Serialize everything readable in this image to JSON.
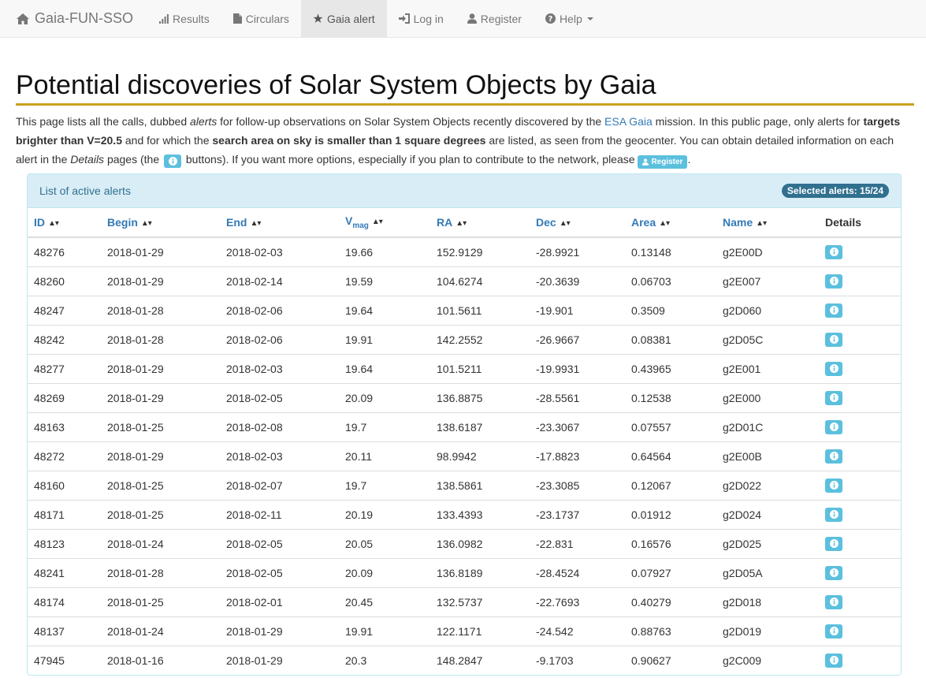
{
  "navbar": {
    "brand": "Gaia-FUN-SSO",
    "items": [
      {
        "label": "Results",
        "icon": "bar-chart-icon"
      },
      {
        "label": "Circulars",
        "icon": "file-icon"
      },
      {
        "label": "Gaia alert",
        "icon": "star-icon",
        "active": true
      },
      {
        "label": "Log in",
        "icon": "login-icon"
      },
      {
        "label": "Register",
        "icon": "user-icon"
      },
      {
        "label": "Help",
        "icon": "question-circle-icon",
        "dropdown": true
      }
    ]
  },
  "page": {
    "title": "Potential discoveries of Solar System Objects by Gaia",
    "intro": {
      "t1": "This page lists all the calls, dubbed ",
      "t2": "alerts",
      "t3": " for follow-up observations on Solar System Objects recently discovered by the ",
      "link": "ESA Gaia",
      "t4": " mission. In this public page, only alerts for ",
      "b1": "targets brighter than V=20.5",
      "t5": " and for which the ",
      "b2": "search area on sky is smaller than 1 square degrees",
      "t6": " are listed, as seen from the geocenter. You can obtain detailed information on each alert in the ",
      "t7": "Details",
      "t8": " pages (the ",
      "t9": " buttons). If you want more options, especially if you plan to contribute to the network, please ",
      "register_btn": "Register",
      "t10": "."
    }
  },
  "panel": {
    "title": "List of active alerts",
    "badge": "Selected alerts: 15/24",
    "columns": {
      "id": "ID",
      "begin": "Begin",
      "end": "End",
      "vmag": "V",
      "vmag_sub": "mag",
      "ra": "RA",
      "dec": "Dec",
      "area": "Area",
      "name": "Name",
      "details": "Details"
    },
    "rows": [
      {
        "id": "48276",
        "begin": "2018-01-29",
        "end": "2018-02-03",
        "vmag": "19.66",
        "ra": "152.9129",
        "dec": "-28.9921",
        "area": "0.13148",
        "name": "g2E00D"
      },
      {
        "id": "48260",
        "begin": "2018-01-29",
        "end": "2018-02-14",
        "vmag": "19.59",
        "ra": "104.6274",
        "dec": "-20.3639",
        "area": "0.06703",
        "name": "g2E007"
      },
      {
        "id": "48247",
        "begin": "2018-01-28",
        "end": "2018-02-06",
        "vmag": "19.64",
        "ra": "101.5611",
        "dec": "-19.901",
        "area": "0.3509",
        "name": "g2D060"
      },
      {
        "id": "48242",
        "begin": "2018-01-28",
        "end": "2018-02-06",
        "vmag": "19.91",
        "ra": "142.2552",
        "dec": "-26.9667",
        "area": "0.08381",
        "name": "g2D05C"
      },
      {
        "id": "48277",
        "begin": "2018-01-29",
        "end": "2018-02-03",
        "vmag": "19.64",
        "ra": "101.5211",
        "dec": "-19.9931",
        "area": "0.43965",
        "name": "g2E001"
      },
      {
        "id": "48269",
        "begin": "2018-01-29",
        "end": "2018-02-05",
        "vmag": "20.09",
        "ra": "136.8875",
        "dec": "-28.5561",
        "area": "0.12538",
        "name": "g2E000"
      },
      {
        "id": "48163",
        "begin": "2018-01-25",
        "end": "2018-02-08",
        "vmag": "19.7",
        "ra": "138.6187",
        "dec": "-23.3067",
        "area": "0.07557",
        "name": "g2D01C"
      },
      {
        "id": "48272",
        "begin": "2018-01-29",
        "end": "2018-02-03",
        "vmag": "20.11",
        "ra": "98.9942",
        "dec": "-17.8823",
        "area": "0.64564",
        "name": "g2E00B"
      },
      {
        "id": "48160",
        "begin": "2018-01-25",
        "end": "2018-02-07",
        "vmag": "19.7",
        "ra": "138.5861",
        "dec": "-23.3085",
        "area": "0.12067",
        "name": "g2D022"
      },
      {
        "id": "48171",
        "begin": "2018-01-25",
        "end": "2018-02-11",
        "vmag": "20.19",
        "ra": "133.4393",
        "dec": "-23.1737",
        "area": "0.01912",
        "name": "g2D024"
      },
      {
        "id": "48123",
        "begin": "2018-01-24",
        "end": "2018-02-05",
        "vmag": "20.05",
        "ra": "136.0982",
        "dec": "-22.831",
        "area": "0.16576",
        "name": "g2D025"
      },
      {
        "id": "48241",
        "begin": "2018-01-28",
        "end": "2018-02-05",
        "vmag": "20.09",
        "ra": "136.8189",
        "dec": "-28.4524",
        "area": "0.07927",
        "name": "g2D05A"
      },
      {
        "id": "48174",
        "begin": "2018-01-25",
        "end": "2018-02-01",
        "vmag": "20.45",
        "ra": "132.5737",
        "dec": "-22.7693",
        "area": "0.40279",
        "name": "g2D018"
      },
      {
        "id": "48137",
        "begin": "2018-01-24",
        "end": "2018-01-29",
        "vmag": "19.91",
        "ra": "122.1171",
        "dec": "-24.542",
        "area": "0.88763",
        "name": "g2D019"
      },
      {
        "id": "47945",
        "begin": "2018-01-16",
        "end": "2018-01-29",
        "vmag": "20.3",
        "ra": "148.2847",
        "dec": "-9.1703",
        "area": "0.90627",
        "name": "g2C009"
      }
    ]
  },
  "colors": {
    "accent": "#c8a21e",
    "info": "#5bc0de",
    "link": "#337ab7",
    "panel_heading_bg": "#d9edf7",
    "panel_text": "#31708f"
  }
}
